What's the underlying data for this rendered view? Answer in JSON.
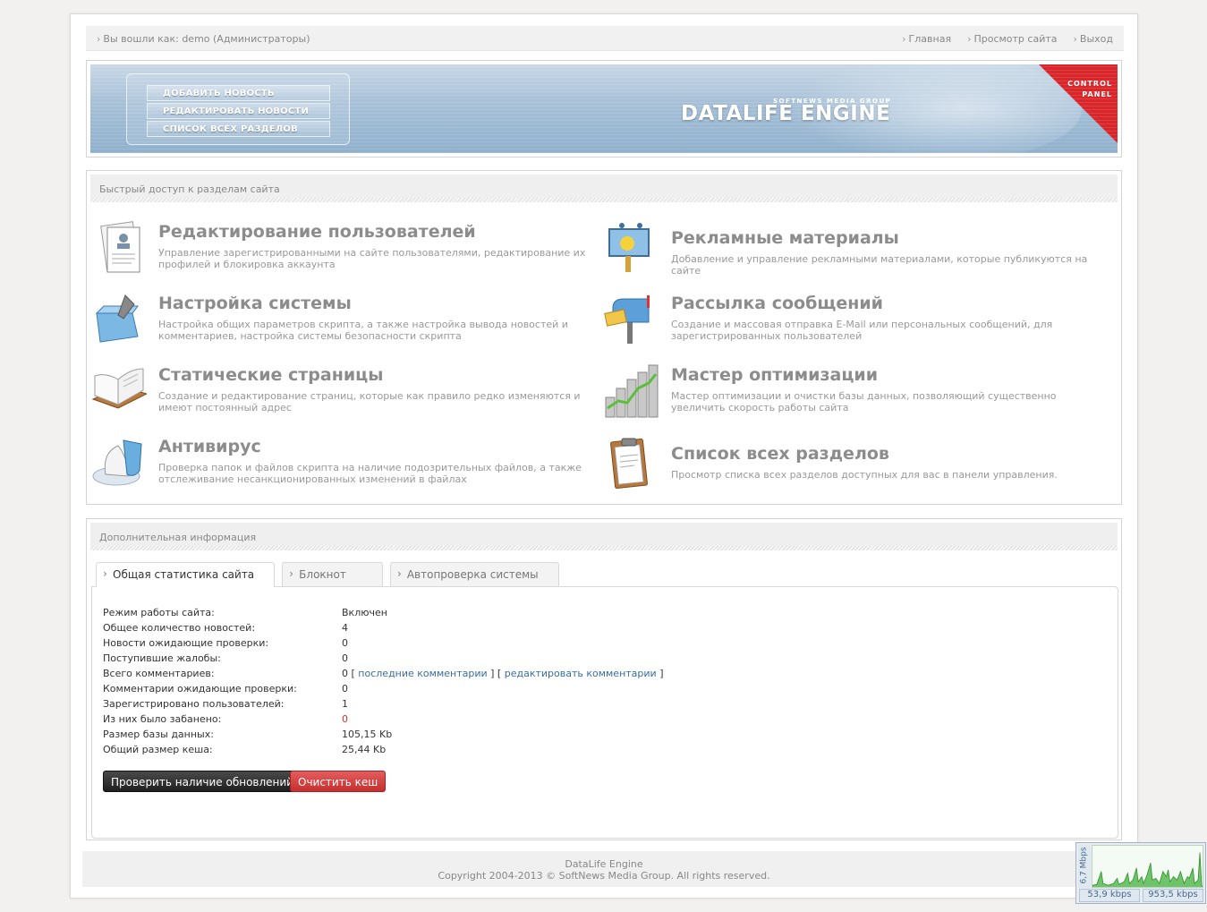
{
  "topbar": {
    "login": "Вы вошли как: demo (Администраторы)",
    "links": [
      "Главная",
      "Просмотр сайта",
      "Выход"
    ]
  },
  "banner": {
    "menu": [
      "ДОБАВИТЬ НОВОСТЬ",
      "РЕДАКТИРОВАТЬ НОВОСТИ",
      "СПИСОК ВСЕХ РАЗДЕЛОВ"
    ],
    "logo_small": "SOFTNEWS MEDIA GROUP",
    "logo_big": "DATALIFE ENGINE",
    "corner_line1": "CONTROL",
    "corner_line2": "PANEL"
  },
  "quick": {
    "header": "Быстрый доступ к разделам сайта",
    "items": [
      {
        "title": "Редактирование пользователей",
        "desc": "Управление зарегистрированными на сайте пользователями, редактирование их профилей и блокировка аккаунта",
        "icon": "users-document-icon"
      },
      {
        "title": "Рекламные материалы",
        "desc": "Добавление и управление рекламными материалами, которые публикуются на сайте",
        "icon": "billboard-icon"
      },
      {
        "title": "Настройка системы",
        "desc": "Настройка общих параметров скрипта, а также настройка вывода новостей и комментариев, настройка системы безопасности скрипта",
        "icon": "toolbox-icon"
      },
      {
        "title": "Рассылка сообщений",
        "desc": "Создание и массовая отправка E-Mail или персональных сообщений, для зарегистрированных пользователей",
        "icon": "mailbox-icon"
      },
      {
        "title": "Статические страницы",
        "desc": "Создание и редактирование страниц, которые как правило редко изменяются и имеют постоянный адрес",
        "icon": "open-book-icon"
      },
      {
        "title": "Мастер оптимизации",
        "desc": "Мастер оптимизации и очистки базы данных, позволяющий существенно увеличить скорость работы сайта",
        "icon": "growth-chart-icon"
      },
      {
        "title": "Антивирус",
        "desc": "Проверка папок и файлов скрипта на наличие подозрительных файлов, а также отслеживание несанкционированных изменений в файлах",
        "icon": "antivirus-icon"
      },
      {
        "title": "Список всех разделов",
        "desc": "Просмотр списка всех разделов доступных для вас в панели управления.",
        "icon": "clipboard-icon"
      }
    ]
  },
  "info": {
    "header": "Дополнительная информация",
    "tabs": [
      "Общая статистика сайта",
      "Блокнот",
      "Автопроверка системы"
    ],
    "stats": [
      {
        "label": "Режим работы сайта:",
        "value": "Включен"
      },
      {
        "label": "Общее количество новостей:",
        "value": "4"
      },
      {
        "label": "Новости ожидающие проверки:",
        "value": "0"
      },
      {
        "label": "Поступившие жалобы:",
        "value": "0"
      },
      {
        "label": "Всего комментариев:",
        "value": "0"
      },
      {
        "label": "Комментарии ожидающие проверки:",
        "value": "0"
      },
      {
        "label": "Зарегистрировано пользователей:",
        "value": "1"
      },
      {
        "label": "Из них было забанено:",
        "value": "0"
      },
      {
        "label": "Размер базы данных:",
        "value": "105,15 Kb"
      },
      {
        "label": "Общий размер кеша:",
        "value": "25,44 Kb"
      }
    ],
    "link_last_comments": "последние комментарии",
    "link_edit_comments": "редактировать комментарии",
    "btn_check_updates": "Проверить наличие обновлений",
    "btn_clear_cache": "Очистить кеш"
  },
  "footer": {
    "line1": "DataLife Engine",
    "line2": "Copyright 2004-2013 © SoftNews Media Group. All rights reserved."
  },
  "netmon": {
    "axis": "6,7 Mbps",
    "down": "53,9 kbps",
    "up": "953,5 kbps"
  },
  "colors": {
    "banner_blue": "#a8c1d8",
    "corner_red": "#d8262a",
    "link": "#3b6e9c",
    "danger": "#d32f2f"
  }
}
